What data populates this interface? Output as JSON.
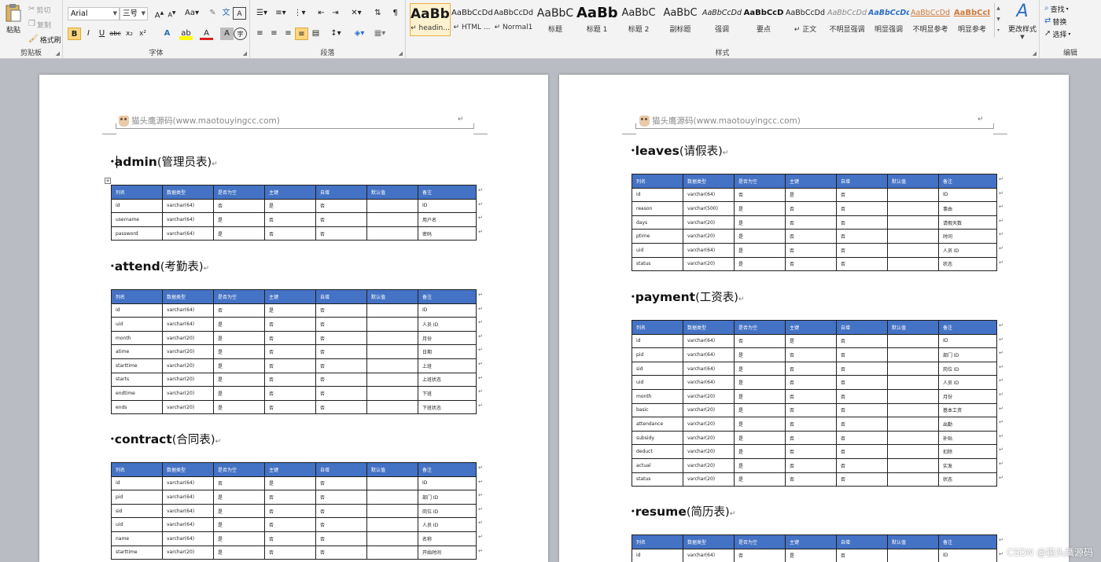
{
  "ribbon": {
    "clipboard": {
      "paste": "粘贴",
      "cut": "剪切",
      "copy": "复制",
      "format_painter": "格式刷",
      "label": "剪贴板"
    },
    "font": {
      "font_name": "Arial",
      "font_size": "三号",
      "label": "字体",
      "buttons": [
        "B",
        "I",
        "U",
        "abc",
        "x₂",
        "x²",
        "A",
        "A",
        "A",
        "A",
        "字"
      ]
    },
    "paragraph": {
      "label": "段落"
    },
    "styles": {
      "label": "样式",
      "tiles": [
        {
          "sample": "AaBb(",
          "name": "↵ headin..."
        },
        {
          "sample": "AaBbCcDd",
          "name": "↵ HTML ..."
        },
        {
          "sample": "AaBbCcDd",
          "name": "↵ Normal1"
        },
        {
          "sample": "AaBbC",
          "name": "标题"
        },
        {
          "sample": "AaBb",
          "name": "标题 1"
        },
        {
          "sample": "AaBbC",
          "name": "标题 2"
        },
        {
          "sample": "AaBbC",
          "name": "副标题"
        },
        {
          "sample": "AaBbCcDd",
          "name": "强调"
        },
        {
          "sample": "AaBbCcD",
          "name": "要点"
        },
        {
          "sample": "AaBbCcDd",
          "name": "↵ 正文"
        },
        {
          "sample": "AaBbCcDd",
          "name": "不明显强调"
        },
        {
          "sample": "AaBbCcDd",
          "name": "明显强调"
        },
        {
          "sample": "AaBbCcDd",
          "name": "不明显参考"
        },
        {
          "sample": "AaBbCcI",
          "name": "明显参考"
        }
      ],
      "change_styles": "更改样式"
    },
    "editing": {
      "find": "查找",
      "replace": "替换",
      "select": "选择",
      "label": "编辑"
    }
  },
  "header": {
    "text": "猫头鹰源码(www.maotouyingcc.com)",
    "mark": "↵"
  },
  "table_header": [
    "列名",
    "数据类型",
    "是否为空",
    "主键",
    "自增",
    "默认值",
    "备注"
  ],
  "page1": {
    "sections": [
      {
        "title_en": "admin",
        "title_cn": "(管理员表)",
        "rows": [
          [
            "id",
            "varchar(64)",
            "否",
            "是",
            "否",
            "",
            "ID"
          ],
          [
            "username",
            "varchar(64)",
            "是",
            "否",
            "否",
            "",
            "用户名"
          ],
          [
            "password",
            "varchar(64)",
            "是",
            "否",
            "否",
            "",
            "密码"
          ]
        ]
      },
      {
        "title_en": "attend",
        "title_cn": "(考勤表)",
        "rows": [
          [
            "id",
            "varchar(64)",
            "否",
            "是",
            "否",
            "",
            "ID"
          ],
          [
            "uid",
            "varchar(64)",
            "是",
            "否",
            "否",
            "",
            "人员 ID"
          ],
          [
            "month",
            "varchar(20)",
            "是",
            "否",
            "否",
            "",
            "月份"
          ],
          [
            "atime",
            "varchar(20)",
            "是",
            "否",
            "否",
            "",
            "日期"
          ],
          [
            "starttime",
            "varchar(20)",
            "是",
            "否",
            "否",
            "",
            "上班"
          ],
          [
            "starts",
            "varchar(20)",
            "是",
            "否",
            "否",
            "",
            "上班状态"
          ],
          [
            "endtime",
            "varchar(20)",
            "是",
            "否",
            "否",
            "",
            "下班"
          ],
          [
            "ends",
            "varchar(20)",
            "是",
            "否",
            "否",
            "",
            "下班状态"
          ]
        ]
      },
      {
        "title_en": "contract",
        "title_cn": "(合同表)",
        "rows": [
          [
            "id",
            "varchar(64)",
            "否",
            "是",
            "否",
            "",
            "ID"
          ],
          [
            "pid",
            "varchar(64)",
            "是",
            "否",
            "否",
            "",
            "部门 ID"
          ],
          [
            "sid",
            "varchar(64)",
            "是",
            "否",
            "否",
            "",
            "岗位 ID"
          ],
          [
            "uid",
            "varchar(64)",
            "是",
            "否",
            "否",
            "",
            "人员 ID"
          ],
          [
            "name",
            "varchar(64)",
            "是",
            "否",
            "否",
            "",
            "名称"
          ],
          [
            "starttime",
            "varchar(20)",
            "是",
            "否",
            "否",
            "",
            "开始时间"
          ]
        ]
      }
    ]
  },
  "page2": {
    "sections": [
      {
        "title_en": "leaves",
        "title_cn": "(请假表)",
        "rows": [
          [
            "id",
            "varchar(64)",
            "否",
            "是",
            "否",
            "",
            "ID"
          ],
          [
            "reason",
            "varchar(500)",
            "是",
            "否",
            "否",
            "",
            "事由"
          ],
          [
            "days",
            "varchar(20)",
            "是",
            "否",
            "否",
            "",
            "请假天数"
          ],
          [
            "ptime",
            "varchar(20)",
            "是",
            "否",
            "否",
            "",
            "时间"
          ],
          [
            "uid",
            "varchar(64)",
            "是",
            "否",
            "否",
            "",
            "人员 ID"
          ],
          [
            "status",
            "varchar(20)",
            "是",
            "否",
            "否",
            "",
            "状态"
          ]
        ]
      },
      {
        "title_en": "payment",
        "title_cn": "(工资表)",
        "rows": [
          [
            "id",
            "varchar(64)",
            "否",
            "是",
            "否",
            "",
            "ID"
          ],
          [
            "pid",
            "varchar(64)",
            "是",
            "否",
            "否",
            "",
            "部门 ID"
          ],
          [
            "sid",
            "varchar(64)",
            "是",
            "否",
            "否",
            "",
            "岗位 ID"
          ],
          [
            "uid",
            "varchar(64)",
            "是",
            "否",
            "否",
            "",
            "人员 ID"
          ],
          [
            "month",
            "varchar(20)",
            "是",
            "否",
            "否",
            "",
            "月份"
          ],
          [
            "basic",
            "varchar(20)",
            "是",
            "否",
            "否",
            "",
            "基本工资"
          ],
          [
            "attendance",
            "varchar(20)",
            "是",
            "否",
            "否",
            "",
            "出勤"
          ],
          [
            "subsidy",
            "varchar(20)",
            "是",
            "否",
            "否",
            "",
            "补贴"
          ],
          [
            "deduct",
            "varchar(20)",
            "是",
            "否",
            "否",
            "",
            "扣除"
          ],
          [
            "actual",
            "varchar(20)",
            "是",
            "否",
            "否",
            "",
            "实发"
          ],
          [
            "status",
            "varchar(20)",
            "是",
            "否",
            "否",
            "",
            "状态"
          ]
        ]
      },
      {
        "title_en": "resume",
        "title_cn": "(简历表)",
        "rows": [
          [
            "id",
            "varchar(64)",
            "否",
            "是",
            "否",
            "",
            "ID"
          ]
        ]
      }
    ]
  },
  "watermark": "CSDN @猫头鹰源码",
  "colors": {
    "table_header_bg": "#4472c4",
    "ribbon_bg": "#f3f3f3",
    "workspace_bg": "#b9bdc3"
  }
}
